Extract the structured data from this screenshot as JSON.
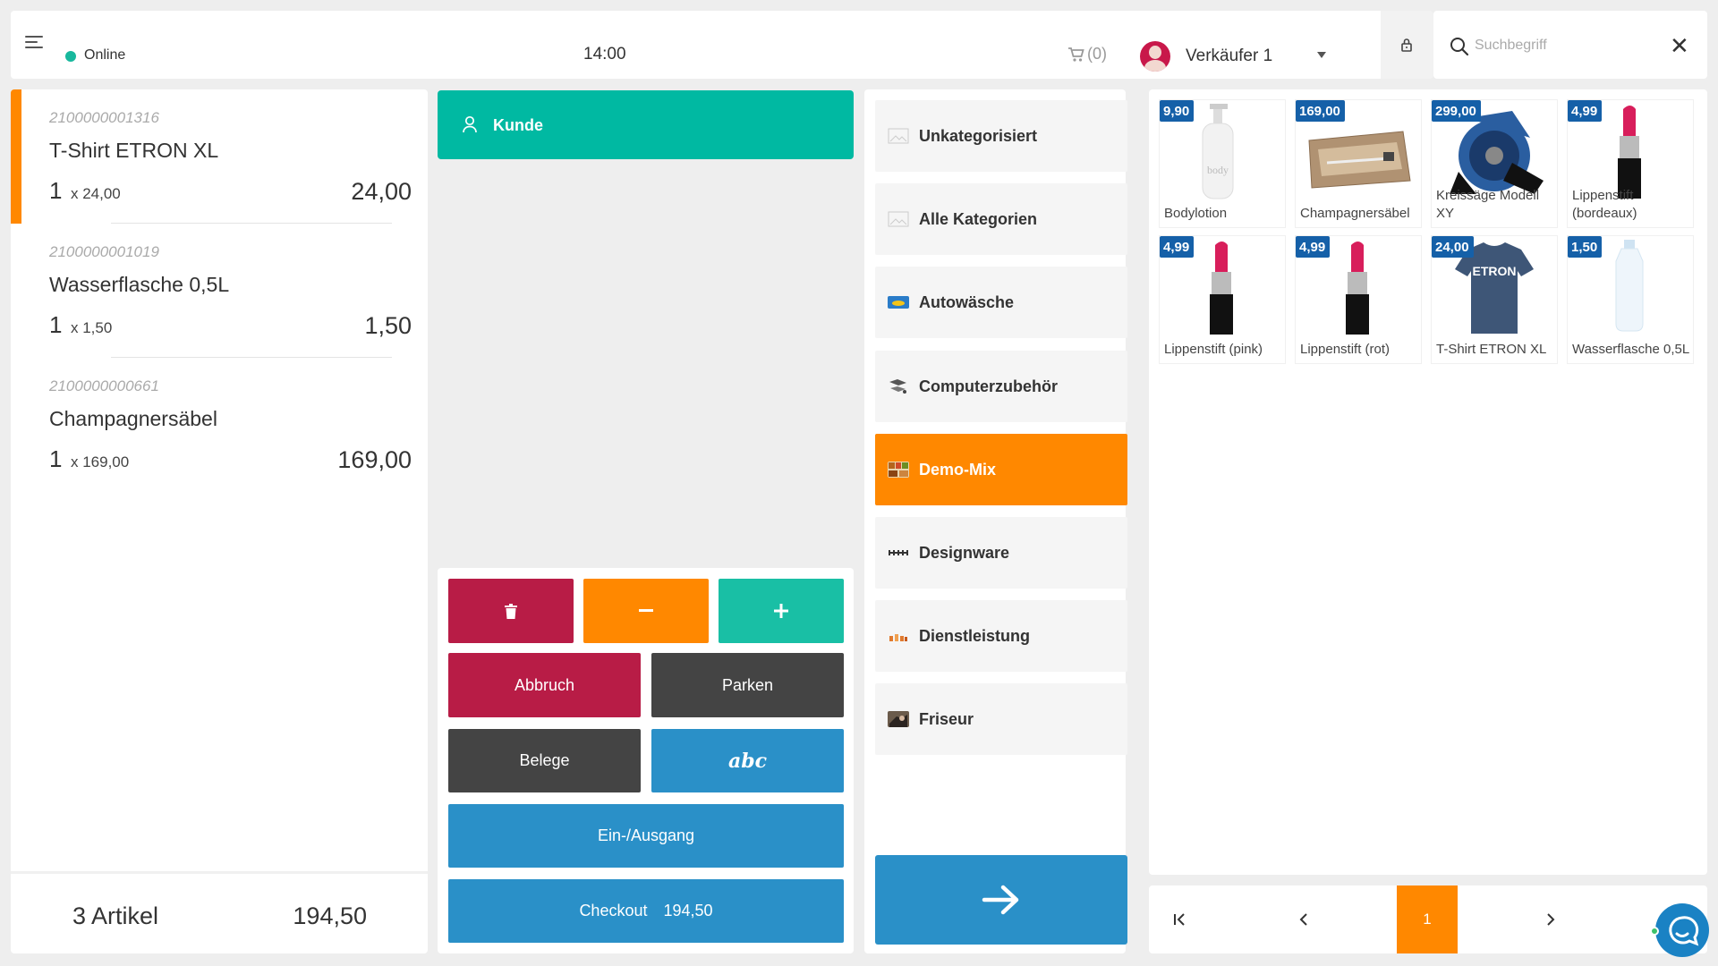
{
  "topbar": {
    "status": "Online",
    "time": "14:00",
    "cart_count": "(0)",
    "seller": "Verkäufer 1"
  },
  "search": {
    "placeholder": "Suchbegriff",
    "value": ""
  },
  "cart": {
    "items": [
      {
        "code": "2100000001316",
        "name": "T-Shirt ETRON XL",
        "qty": "1",
        "unit": "x 24,00",
        "total": "24,00"
      },
      {
        "code": "2100000001019",
        "name": "Wasserflasche 0,5L",
        "qty": "1",
        "unit": "x 1,50",
        "total": "1,50"
      },
      {
        "code": "2100000000661",
        "name": "Champagnersäbel",
        "qty": "1",
        "unit": "x 169,00",
        "total": "169,00"
      }
    ],
    "count_label": "3 Artikel",
    "sum": "194,50"
  },
  "customer": {
    "label": "Kunde"
  },
  "actions": {
    "cancel": "Abbruch",
    "park": "Parken",
    "receipts": "Belege",
    "abc": "abc",
    "in_out": "Ein-/Ausgang",
    "checkout": "Checkout",
    "checkout_amount": "194,50"
  },
  "categories": [
    {
      "label": "Unkategorisiert",
      "icon": "image-placeholder-icon",
      "active": false
    },
    {
      "label": "Alle Kategorien",
      "icon": "image-placeholder-icon",
      "active": false
    },
    {
      "label": "Autowäsche",
      "icon": "car-wash-thumb",
      "active": false
    },
    {
      "label": "Computerzubehör",
      "icon": "computer-accessory-thumb",
      "active": false
    },
    {
      "label": "Demo-Mix",
      "icon": "demo-mix-thumb",
      "active": true
    },
    {
      "label": "Designware",
      "icon": "designer-logo-thumb",
      "active": false
    },
    {
      "label": "Dienstleistung",
      "icon": "service-thumb",
      "active": false
    },
    {
      "label": "Friseur",
      "icon": "hairdresser-thumb",
      "active": false
    }
  ],
  "products": [
    {
      "price": "9,90",
      "name": "Bodylotion",
      "image": "bodylotion-bottle"
    },
    {
      "price": "169,00",
      "name": "Champagnersäbel",
      "image": "champagne-saber-box"
    },
    {
      "price": "299,00",
      "name": "Kreissäge Modell XY",
      "image": "circular-saw"
    },
    {
      "price": "4,99",
      "name": "Lippenstift (bordeaux)",
      "image": "lipstick"
    },
    {
      "price": "4,99",
      "name": "Lippenstift (pink)",
      "image": "lipstick"
    },
    {
      "price": "4,99",
      "name": "Lippenstift (rot)",
      "image": "lipstick"
    },
    {
      "price": "24,00",
      "name": "T-Shirt ETRON XL",
      "image": "tshirt",
      "logo_text": "ETRON"
    },
    {
      "price": "1,50",
      "name": "Wasserflasche 0,5L",
      "image": "water-bottle"
    }
  ],
  "pager": {
    "current": "1"
  },
  "colors": {
    "accent": "#ff8800",
    "teal": "#00b9a2",
    "red": "#b81c46",
    "dark": "#444444",
    "blue": "#2a90c8",
    "price_badge": "#1560a8"
  }
}
